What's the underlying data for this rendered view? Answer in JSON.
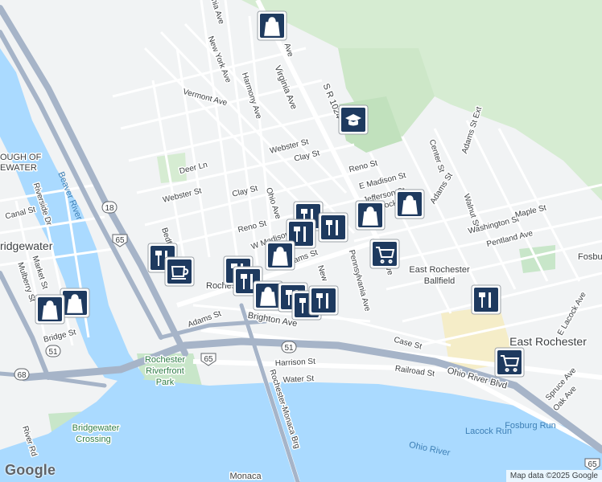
{
  "labels": {
    "virginia_ave": "Virginia Ave",
    "sr1024": "S R 1024",
    "new_york_ave": "New York Ave",
    "vermont_ave": "Vermont Ave",
    "harmony_ave": "Harmony Ave",
    "pennsylvania_ave_top": "vania Ave",
    "ave_top": "Ave",
    "webster_st_1": "Webster St",
    "webster_st_2": "Webster St",
    "clay_st_1": "Clay St",
    "clay_st_2": "Clay St",
    "deer_ln": "Deer Ln",
    "reno_st_1": "Reno St",
    "reno_st_2": "Reno St",
    "ohio_ave": "Ohio Ave",
    "w_madison": "W Madison",
    "e_madison_st": "E Madison St",
    "jefferson_st": "Jefferson St",
    "lock": "ock",
    "adams_st_1": "Adams St",
    "adams_st_2": "Adams St",
    "adams_st_3": "Adams St",
    "adams_st_ext": "Adams St Ext",
    "center_st": "Center St",
    "walnut_st": "Walnut St",
    "washington_st": "Washington St",
    "maple_st": "Maple St",
    "pentland_ave": "Pentland Ave",
    "fosb": "Fosbu",
    "e_rochester_ballfield_1": "East Rochester",
    "e_rochester_ballfield_2": "Ballfield",
    "e_lacock_ave": "E Lacock Ave",
    "pennsylvania_ave": "Pennsylvania Ave",
    "new": "New",
    "ave_mid": "ve",
    "rochester": "Rochester",
    "brighton_ave": "Brighton Ave",
    "case_st": "Case St",
    "harrison_st": "Harrison St",
    "water_st": "Water St",
    "railroad_st": "Railroad St",
    "ohio_river_blvd": "Ohio River Blvd",
    "route_51_a": "51",
    "route_51_b": "51",
    "route_65_a": "65",
    "route_65_b": "65",
    "route_18": "18",
    "route_68": "68",
    "rochester_riverfront_1": "Rochester",
    "rochester_riverfront_2": "Riverfront",
    "rochester_riverfront_3": "Park",
    "rochester_monaca_brg": "Rochester-Monaca Brg",
    "east_rochester": "East Rochester",
    "spruce_ave": "Spruce Ave",
    "oak_ave": "Oak Ave",
    "fosburg_run": "Fosburg Run",
    "lacock_run": "Lacock Run",
    "ohio_river": "Ohio River",
    "beaver_river": "Beaver River",
    "borough_1": "OUGH OF",
    "borough_2": "EWATER",
    "canal_st": "Canal St",
    "riverside_dr": "Riverside Dr",
    "bridgewater": "ridgewater",
    "mulberry_st": "Mulberry St",
    "market_st": "Market St",
    "bridge_st": "Bridge St",
    "bridgewater_crossing_1": "Bridgewater",
    "bridgewater_crossing_2": "Crossing",
    "river_rd": "River Rd",
    "monaca": "Monaca",
    "bedford": "Bedfo",
    "route_r": "R",
    "rt_65_c": "65"
  },
  "markers": [
    {
      "icon": "shopping-icon",
      "color": "#1a73e8"
    },
    {
      "icon": "school-icon",
      "color": "#1a73e8"
    },
    {
      "icon": "restaurant-icon",
      "color": "#1a73e8"
    },
    {
      "icon": "shopping-icon",
      "color": "#1a73e8"
    },
    {
      "icon": "grocery-icon",
      "color": "#1a73e8"
    },
    {
      "icon": "cafe-icon",
      "color": "#1a73e8"
    },
    {
      "icon": "restaurant-icon",
      "color": "#1a73e8"
    },
    {
      "icon": "grocery-icon",
      "color": "#1a73e8"
    }
  ],
  "colors": {
    "water": "#aadaff",
    "water_label": "#3d7fb5",
    "park": "#c8e6c9",
    "wooded": "#d6ecd2",
    "sand": "#f5edc8",
    "road": "#ffffff",
    "highway": "#a6b4c8",
    "marker_fill": "#1e3a5f"
  },
  "google_logo": "Google",
  "attribution": "Map data ©2025 Google"
}
